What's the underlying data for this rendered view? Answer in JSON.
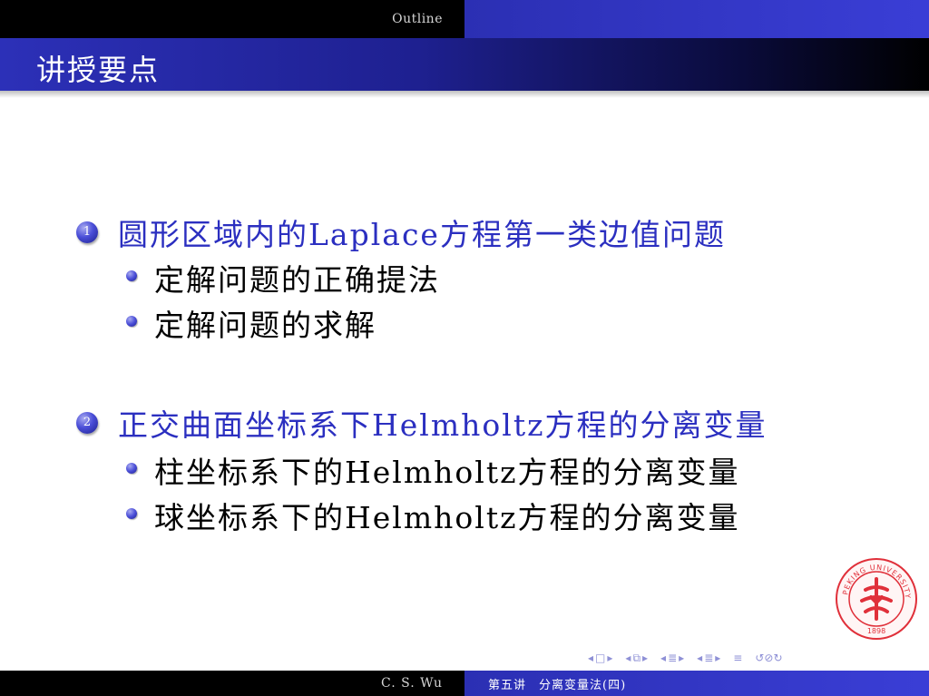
{
  "header": {
    "section": "Outline"
  },
  "frame": {
    "title": "讲授要点"
  },
  "outline": {
    "items": [
      {
        "number": "1",
        "text": "圆形区域内的Laplace方程第一类边值问题",
        "subitems": [
          "定解问题的正确提法",
          "定解问题的求解"
        ]
      },
      {
        "number": "2",
        "text": "正交曲面坐标系下Helmholtz方程的分离变量",
        "subitems": [
          "柱坐标系下的Helmholtz方程的分离变量",
          "球坐标系下的Helmholtz方程的分离变量"
        ]
      }
    ]
  },
  "logo": {
    "text": "PEKING UNIVERSITY",
    "year": "1898",
    "color": "#e0303a"
  },
  "footer": {
    "author": "C. S. Wu",
    "lecture": "第五讲　分离变量法(四)"
  },
  "colors": {
    "accent": "#2b2fc0",
    "bar": "#2b2fb3"
  },
  "nav_icons": [
    "prev-icon",
    "frame-icon",
    "next-icon",
    "prev-subsection-icon",
    "subsection-icon",
    "next-subsection-icon",
    "prev-section-icon",
    "section-icon",
    "next-section-icon",
    "align-icon",
    "search-icon"
  ]
}
